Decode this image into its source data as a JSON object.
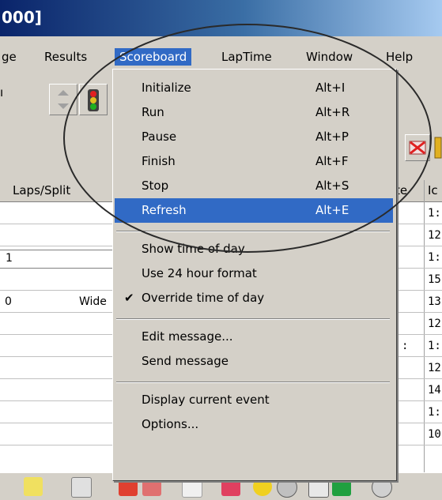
{
  "window": {
    "title_fragment": "000]"
  },
  "menubar": {
    "items": [
      {
        "label": "ge"
      },
      {
        "label": "Results"
      },
      {
        "label": "Scoreboard"
      },
      {
        "label": "LapTime"
      },
      {
        "label": "Window"
      },
      {
        "label": "Help"
      }
    ]
  },
  "grid": {
    "headers": {
      "laps_split": "Laps/Split",
      "col_te": "te",
      "col_id": "Ic"
    },
    "left_cells": [
      "1",
      "0"
    ],
    "wide_label": "Wide",
    "right_col_values": [
      "1:",
      "12",
      "1:",
      "15",
      "13",
      "12",
      "1:",
      "12",
      "14",
      "1:",
      "10"
    ],
    "mid_col_values": [
      "",
      "",
      "",
      "",
      "",
      "",
      ":",
      "",
      "",
      "",
      ""
    ]
  },
  "scoreboard_menu": {
    "items": [
      {
        "label": "Initialize",
        "accel": "Alt+I"
      },
      {
        "label": "Run",
        "accel": "Alt+R"
      },
      {
        "label": "Pause",
        "accel": "Alt+P"
      },
      {
        "label": "Finish",
        "accel": "Alt+F"
      },
      {
        "label": "Stop",
        "accel": "Alt+S"
      },
      {
        "label": "Refresh",
        "accel": "Alt+E"
      }
    ],
    "group2": [
      {
        "label": "Show time of day",
        "checked": false
      },
      {
        "label": "Use 24 hour format",
        "checked": false
      },
      {
        "label": "Override time of day",
        "checked": true
      }
    ],
    "group3": [
      {
        "label": "Edit message..."
      },
      {
        "label": "Send message"
      }
    ],
    "group4": [
      {
        "label": "Display current event"
      },
      {
        "label": "Options..."
      }
    ],
    "highlighted": "Refresh",
    "check_glyph": "✔"
  },
  "colors": {
    "highlight": "#316ac5",
    "face": "#d4d0c8",
    "titlebar": "#0a246a"
  }
}
